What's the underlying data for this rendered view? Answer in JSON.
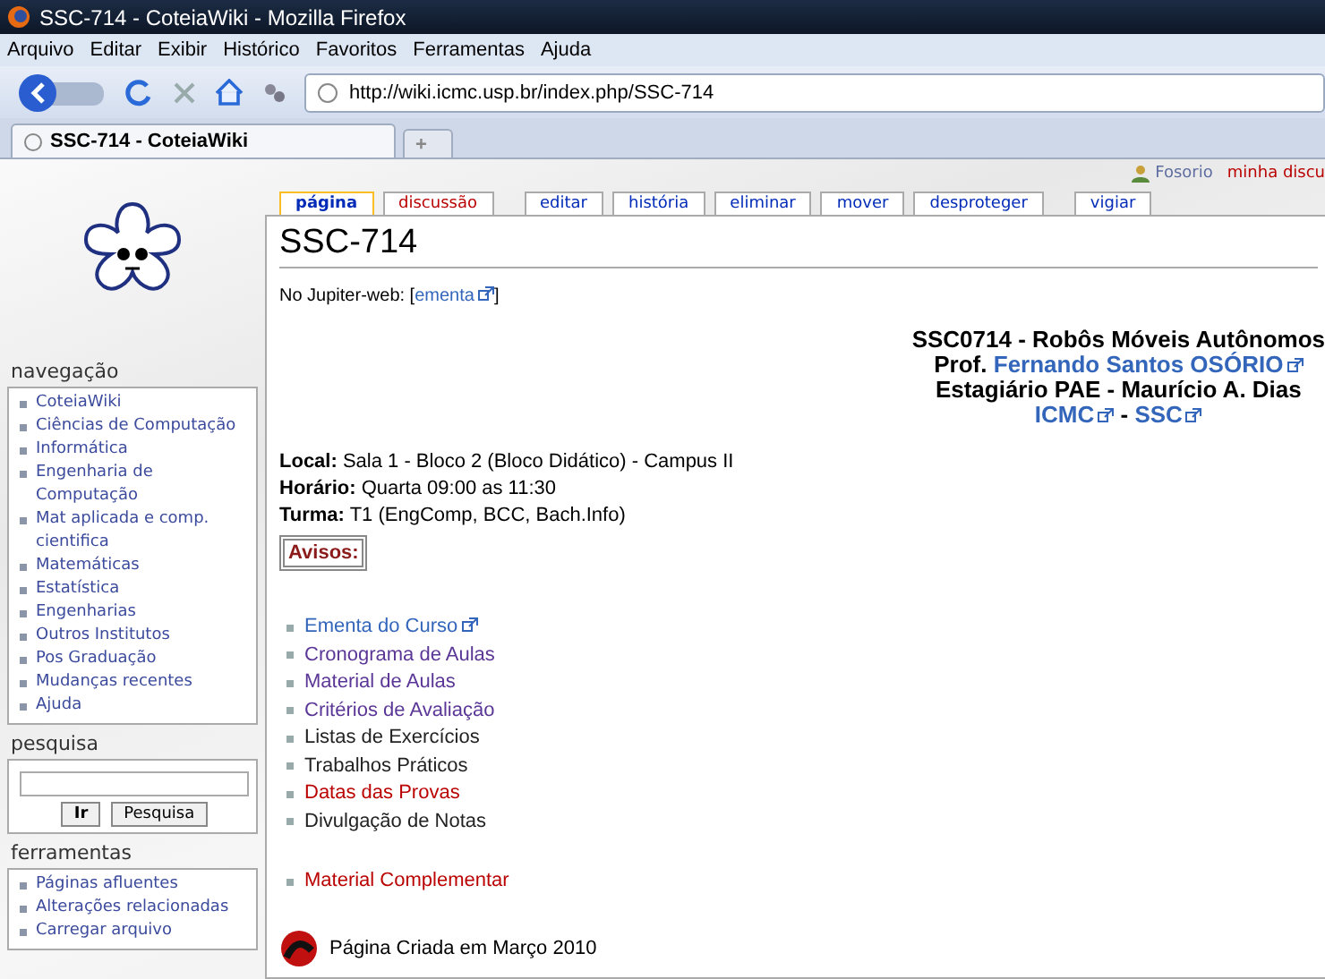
{
  "window": {
    "title": "SSC-714 - CoteiaWiki - Mozilla Firefox"
  },
  "menu": [
    "Arquivo",
    "Editar",
    "Exibir",
    "Histórico",
    "Favoritos",
    "Ferramentas",
    "Ajuda"
  ],
  "address": {
    "value": "http://wiki.icmc.usp.br/index.php/SSC-714"
  },
  "browser_tabs": [
    {
      "label": "SSC-714 - CoteiaWiki",
      "selected": true
    },
    {
      "label": "+",
      "selected": false
    }
  ],
  "personal": [
    {
      "label": "Fosorio",
      "kind": "user"
    },
    {
      "label": "minha discu",
      "kind": "new"
    }
  ],
  "page_tabs": [
    {
      "label": "página",
      "selected": true,
      "kind": "link"
    },
    {
      "label": "discussão",
      "selected": false,
      "kind": "new"
    },
    {
      "label": "editar",
      "selected": false,
      "kind": "link"
    },
    {
      "label": "história",
      "selected": false,
      "kind": "link"
    },
    {
      "label": "eliminar",
      "selected": false,
      "kind": "link"
    },
    {
      "label": "mover",
      "selected": false,
      "kind": "link"
    },
    {
      "label": "desproteger",
      "selected": false,
      "kind": "link"
    },
    {
      "label": "vigiar",
      "selected": false,
      "kind": "link"
    }
  ],
  "sidebar": {
    "navigation": {
      "title": "navegação",
      "items": [
        "CoteiaWiki",
        "Ciências de Computação",
        "Informática",
        "Engenharia de Computação",
        "Mat aplicada e comp. cientifica",
        "Matemáticas",
        "Estatística",
        "Engenharias",
        "Outros Institutos",
        "Pos Graduação",
        "Mudanças recentes",
        "Ajuda"
      ]
    },
    "search": {
      "title": "pesquisa",
      "buttons": [
        "Ir",
        "Pesquisa"
      ]
    },
    "tools": {
      "title": "ferramentas",
      "items": [
        "Páginas afluentes",
        "Alterações relacionadas",
        "Carregar arquivo"
      ]
    }
  },
  "content": {
    "heading": "SSC-714",
    "jupiter": {
      "label": "No Jupiter-web: [",
      "link": "ementa",
      "close": "]"
    },
    "course": {
      "title": "SSC0714 - Robôs Móveis Autônomos",
      "prof_label": "Prof.",
      "prof_link": "Fernando Santos OSÓRIO",
      "assistant": "Estagiário PAE - Maurício A. Dias",
      "links": [
        "ICMC",
        "SSC"
      ],
      "separator": "-"
    },
    "info": [
      {
        "label": "Local:",
        "value": "Sala 1 - Bloco 2 (Bloco Didático) - Campus II"
      },
      {
        "label": "Horário:",
        "value": "Quarta 09:00 as 11:30"
      },
      {
        "label": "Turma:",
        "value": "T1 (EngComp, BCC, Bach.Info)"
      }
    ],
    "notice": "Avisos:",
    "links": [
      {
        "label": "Ementa do Curso",
        "kind": "external"
      },
      {
        "label": "Cronograma de Aulas",
        "kind": "visited"
      },
      {
        "label": "Material de Aulas",
        "kind": "visited"
      },
      {
        "label": "Critérios de Avaliação",
        "kind": "visited"
      },
      {
        "label": "Listas de Exercícios",
        "kind": "text"
      },
      {
        "label": "Trabalhos Práticos",
        "kind": "text"
      },
      {
        "label": "Datas das Provas",
        "kind": "new"
      },
      {
        "label": "Divulgação de Notas",
        "kind": "text"
      }
    ],
    "extra_links": [
      {
        "label": "Material Complementar",
        "kind": "new"
      }
    ],
    "footer": "Página Criada em Março 2010"
  }
}
